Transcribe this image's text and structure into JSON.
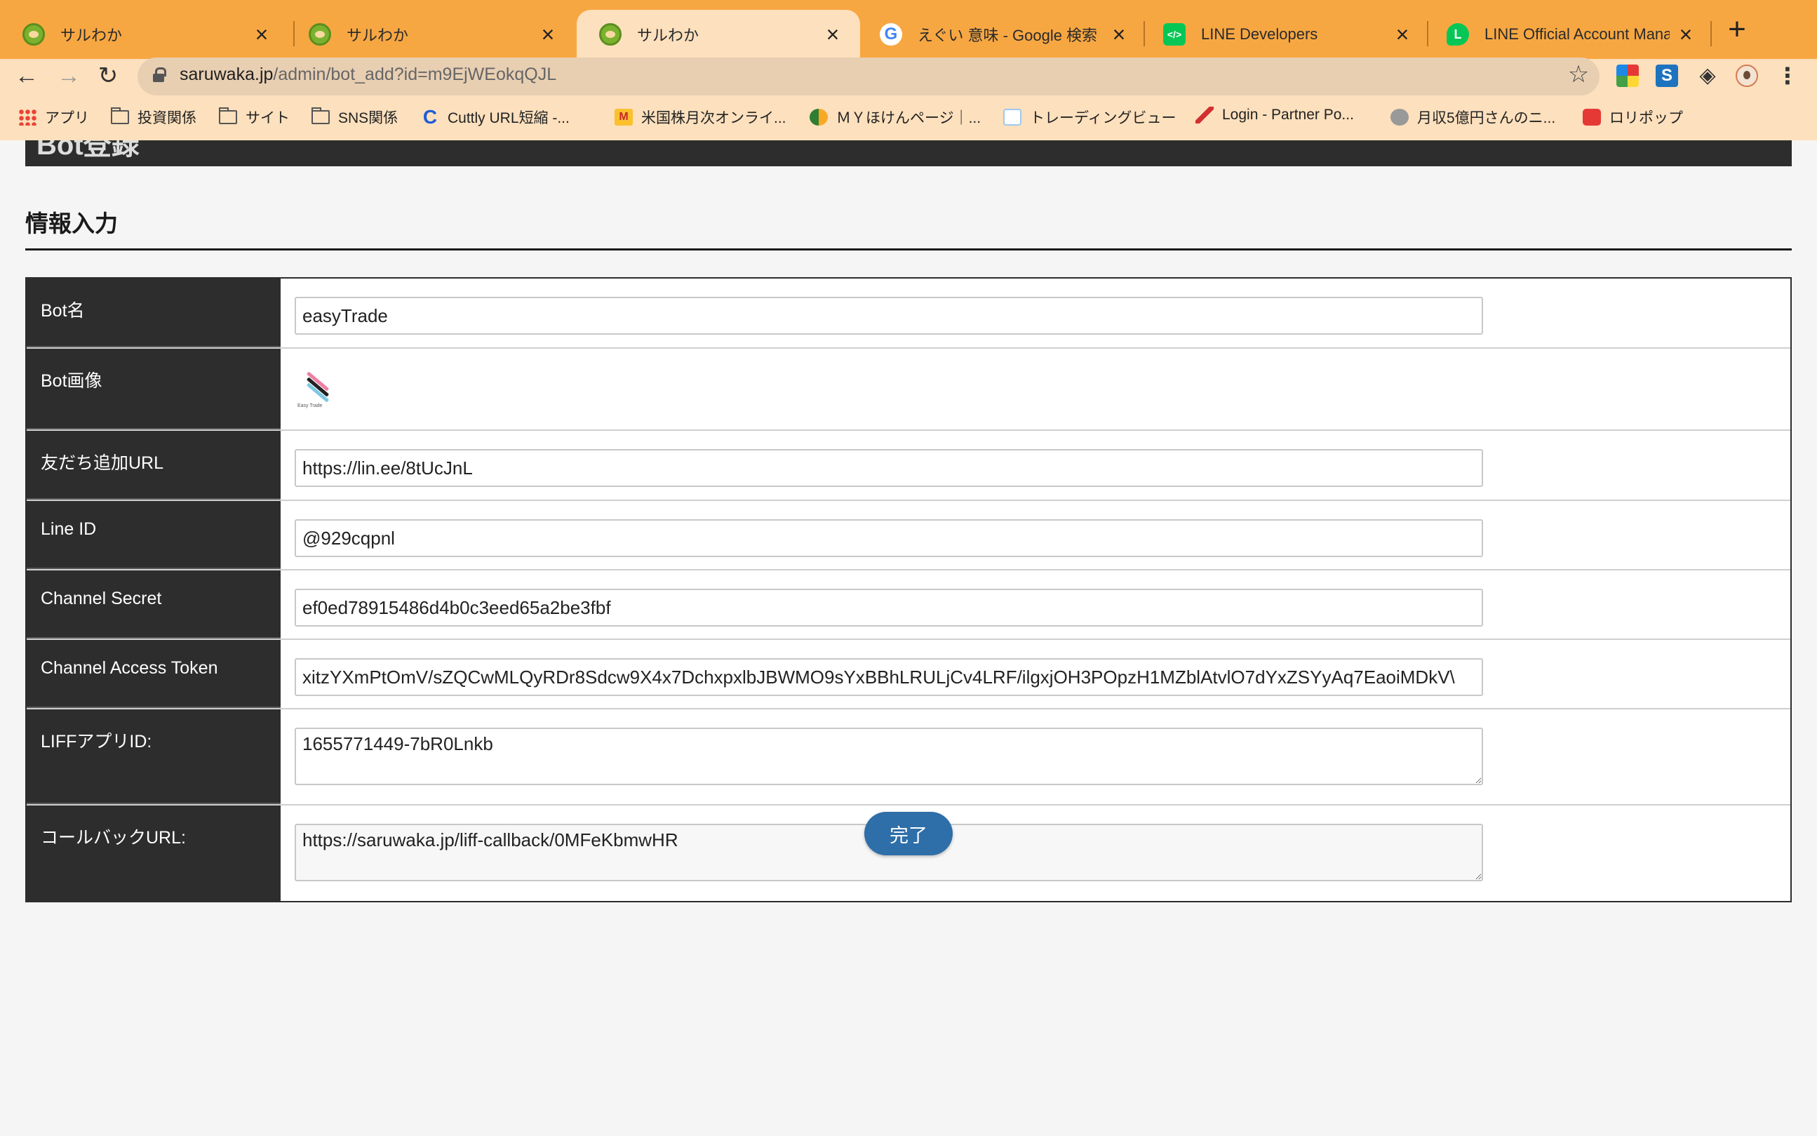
{
  "browser": {
    "tabs": [
      {
        "title": "サルわか",
        "icon": "saruwaka-favicon",
        "active": false
      },
      {
        "title": "サルわか",
        "icon": "saruwaka-favicon",
        "active": false
      },
      {
        "title": "サルわか",
        "icon": "saruwaka-favicon",
        "active": true
      },
      {
        "title": "えぐい 意味 - Google 検索",
        "icon": "google-favicon",
        "active": false
      },
      {
        "title": "LINE Developers",
        "icon": "line-developers-favicon",
        "active": false
      },
      {
        "title": "LINE Official Account Manag",
        "icon": "line-oa-favicon",
        "active": false
      }
    ],
    "tab_close": "×",
    "new_tab": "+",
    "url_host": "saruwaka.jp",
    "url_path": "/admin/bot_add?id=m9EjWEokqQJL",
    "bookmarks": [
      {
        "label": "アプリ",
        "icon": "apps-grid-icon"
      },
      {
        "label": "投資関係",
        "icon": "folder-icon"
      },
      {
        "label": "サイト",
        "icon": "folder-icon"
      },
      {
        "label": "SNS関係",
        "icon": "folder-icon"
      },
      {
        "label": "Cuttly URL短縮 -...",
        "icon": "cuttly-icon"
      },
      {
        "label": "米国株月次オンライ...",
        "icon": "mcdonalds-icon"
      },
      {
        "label": "ＭＹほけんページ｜...",
        "icon": "my-hoken-icon"
      },
      {
        "label": "トレーディングビュー",
        "icon": "tradingview-icon"
      },
      {
        "label": "Login - Partner Po...",
        "icon": "partner-login-icon"
      },
      {
        "label": "月収5億円さんのニ...",
        "icon": "coin-icon"
      },
      {
        "label": "ロリポップ",
        "icon": "lolipop-icon"
      }
    ]
  },
  "page": {
    "banner_title": "Bot登録",
    "section_title": "情報入力",
    "fields": [
      {
        "label": "Bot名",
        "value": "easyTrade"
      },
      {
        "label": "Bot画像",
        "image_caption": "Easy Trade"
      },
      {
        "label": "友だち追加URL",
        "value": "https://lin.ee/8tUcJnL"
      },
      {
        "label": "Line ID",
        "value": "@929cqpnl"
      },
      {
        "label": "Channel Secret",
        "value": "ef0ed78915486d4b0c3eed65a2be3fbf"
      },
      {
        "label": "Channel Access Token",
        "value": "xitzYXmPtOmV/sZQCwMLQyRDr8Sdcw9X4x7DchxpxlbJBWMO9sYxBBhLRULjCv4LRF/ilgxjOH3POpzH1MZblAtvlO7dYxZSYyAq7EaoiMDkV\\"
      },
      {
        "label": "LIFFアプリID:",
        "value": "1655771449-7bR0Lnkb"
      },
      {
        "label": "コールバックURL:",
        "value": "https://saruwaka.jp/liff-callback/0MFeKbmwHR"
      }
    ],
    "submit_label": "完了"
  },
  "colors": {
    "tabstrip": "#f7a742",
    "toolbar": "#fde0bd",
    "label_bg": "#2d2d2d",
    "submit_bg": "#2e6ea9"
  }
}
